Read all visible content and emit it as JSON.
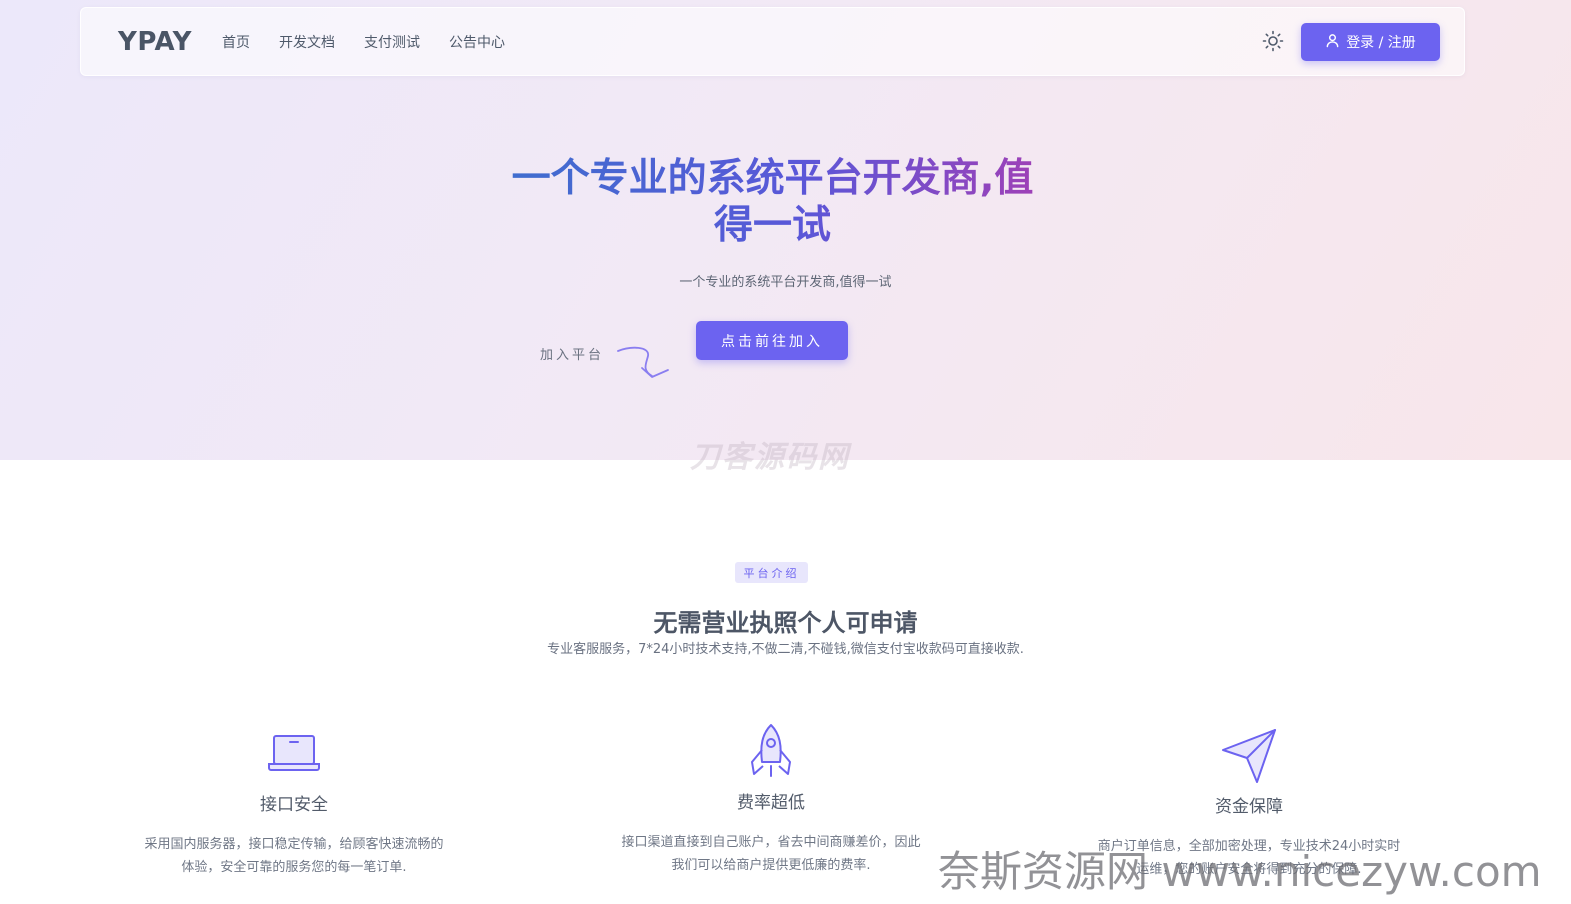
{
  "header": {
    "brand": "YPAY",
    "nav": [
      "首页",
      "开发文档",
      "支付测试",
      "公告中心"
    ],
    "login_label": "登录 / 注册"
  },
  "hero": {
    "title": "一个专业的系统平台开发商,值得一试",
    "subtitle": "一个专业的系统平台开发商,值得一试",
    "join_label": "加入平台",
    "cta_label": "点击前往加入",
    "watermark": "刀客源码网"
  },
  "intro": {
    "badge": "平台介绍",
    "title": "无需营业执照个人可申请",
    "description": "专业客服服务，7*24小时技术支持,不做二清,不碰钱,微信支付宝收款码可直接收款."
  },
  "features": [
    {
      "icon": "laptop-icon",
      "title": "接口安全",
      "description": "采用国内服务器，接口稳定传输，给顾客快速流畅的体验，安全可靠的服务您的每一笔订单."
    },
    {
      "icon": "rocket-icon",
      "title": "费率超低",
      "description": "接口渠道直接到自己账户，省去中间商赚差价，因此我们可以给商户提供更低廉的费率."
    },
    {
      "icon": "paper-plane-icon",
      "title": "资金保障",
      "description": "商户订单信息，全部加密处理，专业技术24小时实时运维，您的账户安全将得到充分的保障."
    }
  ],
  "watermark_bottom": "奈斯资源网 www.nicezyw.com",
  "colors": {
    "accent": "#6c63f0",
    "title_gradient_start": "#3e6fce",
    "title_gradient_end": "#a23fb5"
  }
}
